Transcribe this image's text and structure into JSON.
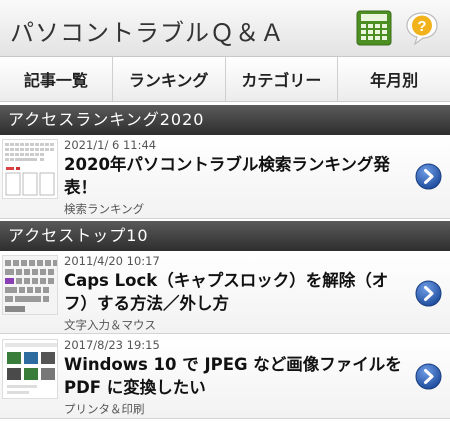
{
  "header": {
    "title": "パソコントラブルＱ＆Ａ",
    "calculator_icon": "calculator-icon",
    "help_icon": "help-bubble-icon",
    "help_symbol": "?"
  },
  "nav": {
    "items": [
      {
        "label": "記事一覧"
      },
      {
        "label": "ランキング"
      },
      {
        "label": "カテゴリー"
      },
      {
        "label": "年月別"
      }
    ]
  },
  "sections": [
    {
      "title": "アクセスランキング2020",
      "articles": [
        {
          "date": "2021/1/ 6 11:44",
          "title": "2020年パソコントラブル検索ランキング発表！",
          "category": "検索ランキング"
        }
      ]
    },
    {
      "title": "アクセストップ10",
      "articles": [
        {
          "date": "2011/4/20 10:17",
          "title": "Caps Lock（キャプスロック）を解除（オフ）する方法／外し方",
          "category": "文字入力＆マウス"
        },
        {
          "date": "2017/8/23 19:15",
          "title": "Windows 10 で JPEG など画像ファイルを PDF に変換したい",
          "category": "プリンタ＆印刷"
        }
      ]
    }
  ],
  "colors": {
    "section_bar": "#3a3a3a",
    "arrow_button": "#2d5fb0",
    "calculator": "#5a9a2e",
    "help_bubble": "#f2b21b"
  }
}
